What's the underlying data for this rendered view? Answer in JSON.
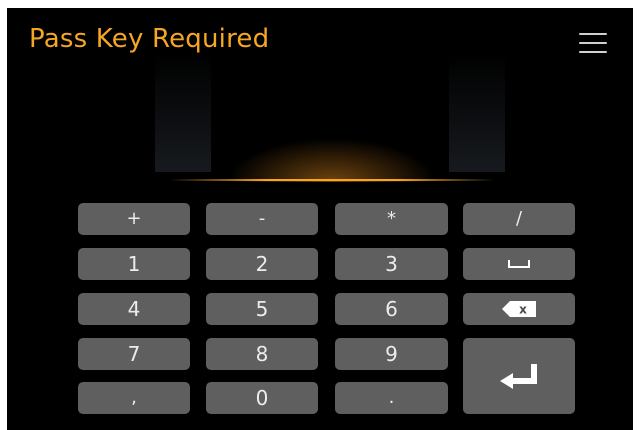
{
  "header": {
    "title": "Pass Key Required"
  },
  "keypad": {
    "keys": [
      "+",
      "-",
      "*",
      "/",
      "1",
      "2",
      "3",
      "4",
      "5",
      "6",
      "7",
      "8",
      "9",
      ",",
      "0",
      "."
    ],
    "space_key_icon": "space-icon",
    "backspace_key_icon": "backspace-icon",
    "backspace_glyph": "x",
    "enter_key_icon": "enter-icon"
  },
  "colors": {
    "accent": "#f5a623",
    "background": "#000000",
    "key": "#5f5f5f",
    "key_text": "#ececec"
  }
}
